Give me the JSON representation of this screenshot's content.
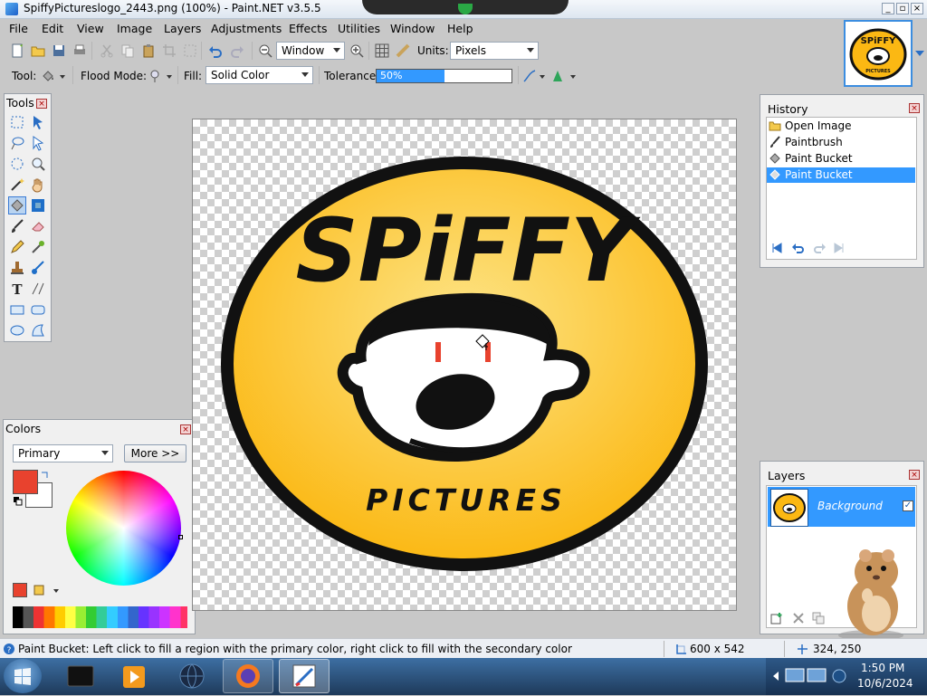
{
  "window": {
    "title": "SpiffyPictureslogo_2443.png (100%) - Paint.NET v3.5.5"
  },
  "menu": [
    "File",
    "Edit",
    "View",
    "Image",
    "Layers",
    "Adjustments",
    "Effects",
    "Utilities",
    "Window",
    "Help"
  ],
  "toolbar": {
    "zoom_value": "Window",
    "units_label": "Units:",
    "units_value": "Pixels",
    "tool_label": "Tool:",
    "flood_label": "Flood Mode:",
    "fill_label": "Fill:",
    "fill_value": "Solid Color",
    "tolerance_label": "Tolerance:",
    "tolerance_value": "50%",
    "tolerance_fraction": 0.5
  },
  "tools_panel": {
    "title": "Tools"
  },
  "colors_panel": {
    "title": "Colors",
    "mode_value": "Primary",
    "more_label": "More >>",
    "primary_color": "#e8422e",
    "secondary_color": "#ffffff"
  },
  "history_panel": {
    "title": "History",
    "items": [
      {
        "label": "Open Image",
        "icon": "folder-icon"
      },
      {
        "label": "Paintbrush",
        "icon": "paintbrush-icon"
      },
      {
        "label": "Paint Bucket",
        "icon": "paint-bucket-icon"
      },
      {
        "label": "Paint Bucket",
        "icon": "paint-bucket-icon",
        "selected": true
      }
    ]
  },
  "layers_panel": {
    "title": "Layers",
    "layers": [
      {
        "label": "Background",
        "visible": true
      }
    ]
  },
  "logo": {
    "line1": "SPiFFY",
    "line2": "PICTURES"
  },
  "thumb": {
    "line1": "SPiFFY",
    "line2": "PICTURES"
  },
  "status": {
    "hint": "Paint Bucket: Left click to fill a region with the primary color, right click to fill with the secondary color",
    "size": "600 x 542",
    "coords": "324, 250"
  },
  "taskbar": {
    "time": "1:50 PM",
    "date": "10/6/2024"
  },
  "colors": {
    "accent": "#3399ff",
    "logo_yellow": "#fbb813",
    "selected_row": "#3399ff"
  }
}
